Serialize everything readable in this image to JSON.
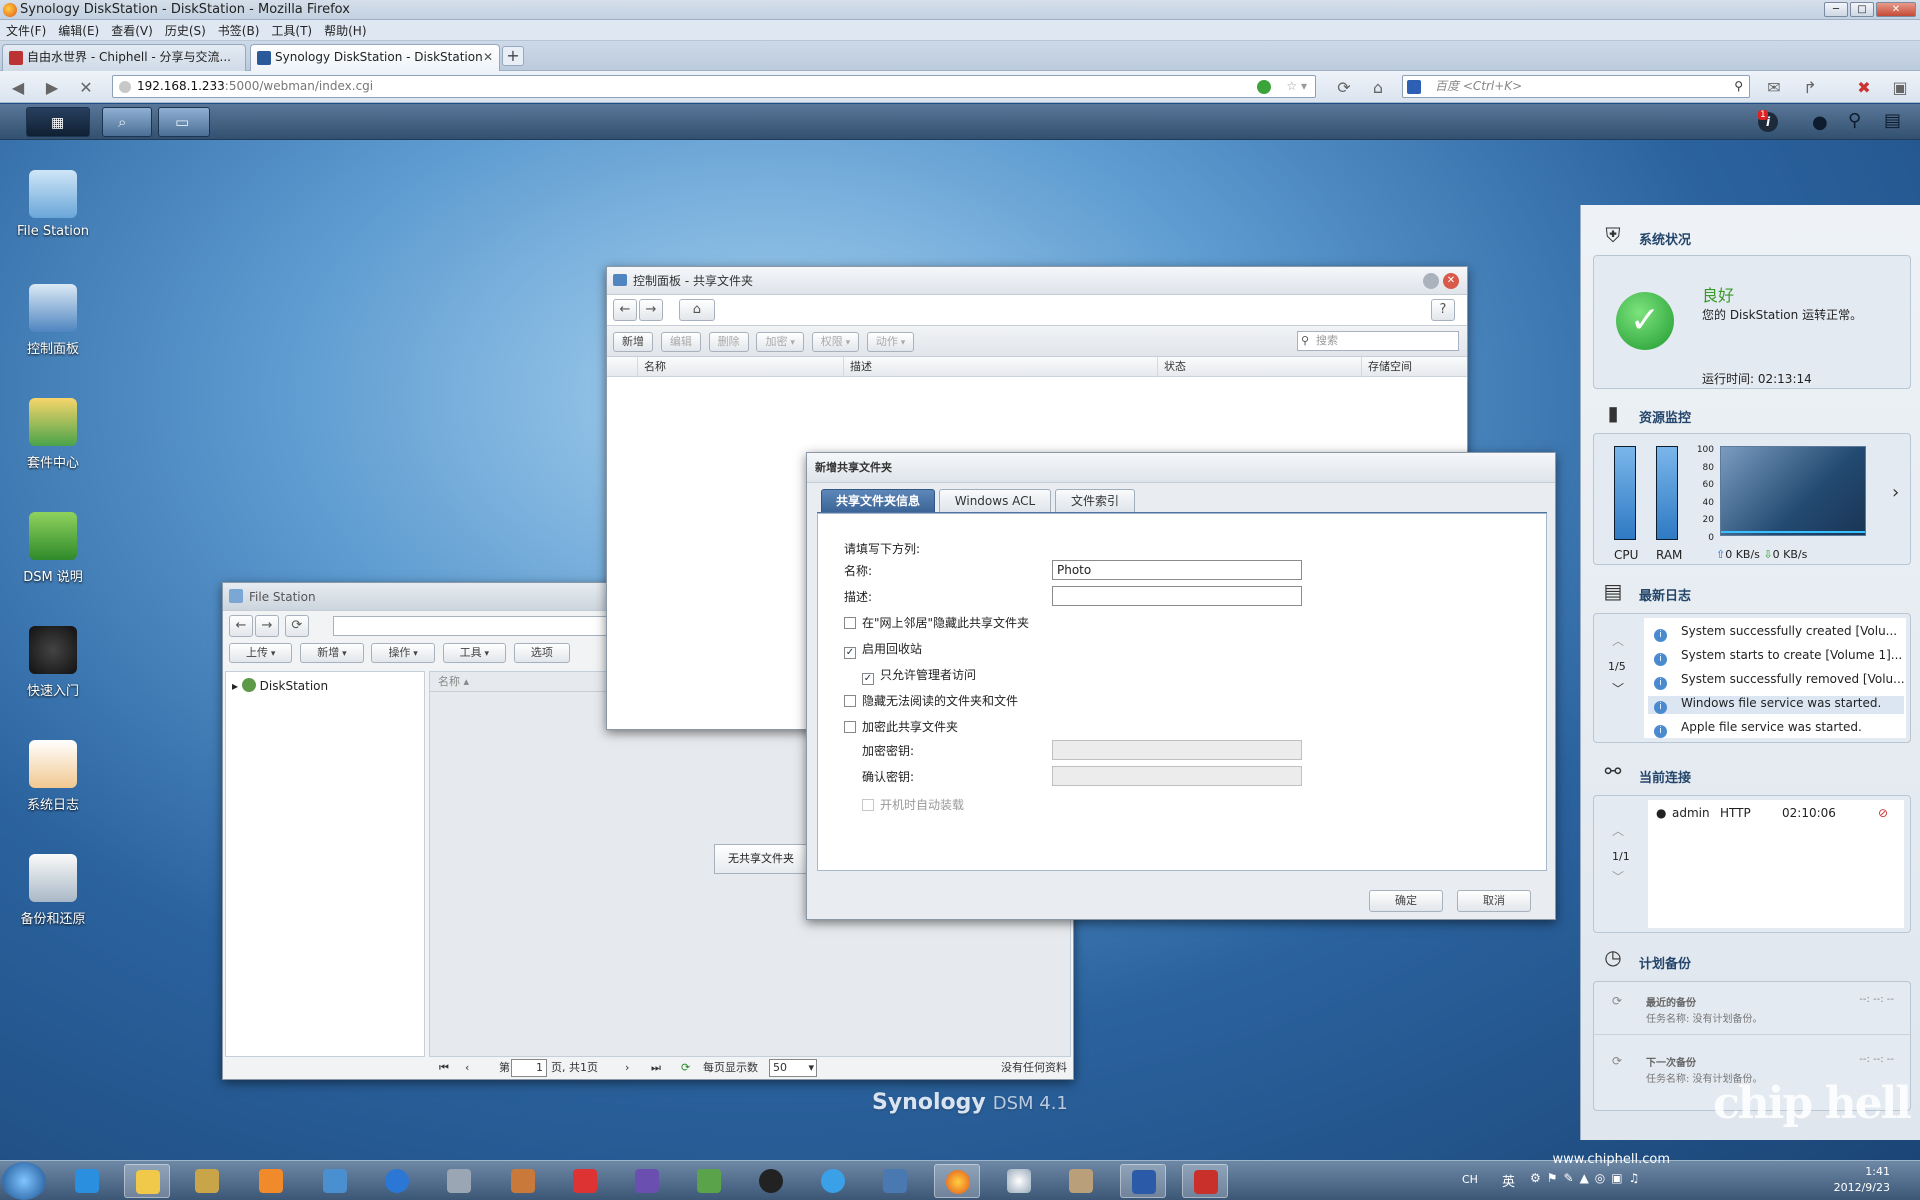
{
  "browser": {
    "title": "Synology DiskStation - DiskStation - Mozilla Firefox",
    "menu": [
      "文件(F)",
      "编辑(E)",
      "查看(V)",
      "历史(S)",
      "书签(B)",
      "工具(T)",
      "帮助(H)"
    ],
    "tabs": [
      {
        "label": "自由水世界 - Chiphell - 分享与交流..."
      },
      {
        "label": "Synology DiskStation - DiskStation"
      }
    ],
    "url_host": "192.168.1.233",
    "url_path": ":5000/webman/index.cgi",
    "search_placeholder": "百度 <Ctrl+K>"
  },
  "dsm": {
    "notification_count": "1"
  },
  "desktop": {
    "icons": [
      {
        "label": "File Station"
      },
      {
        "label": "控制面板"
      },
      {
        "label": "套件中心"
      },
      {
        "label": "DSM 说明"
      },
      {
        "label": "快速入门"
      },
      {
        "label": "系统日志"
      },
      {
        "label": "备份和还原"
      }
    ],
    "logo": "Synology",
    "logo_version": "DSM 4.1"
  },
  "control_panel": {
    "title": "控制面板 - 共享文件夹",
    "toolbar": [
      "新增",
      "编辑",
      "删除",
      "加密",
      "权限",
      "动作"
    ],
    "search_placeholder": "搜索",
    "columns": [
      "名称",
      "描述",
      "状态",
      "存储空间"
    ]
  },
  "file_station": {
    "title": "File Station",
    "toolbar": [
      "上传",
      "新增",
      "操作",
      "工具",
      "选项"
    ],
    "tree_root": "DiskStation",
    "col_name": "名称",
    "empty_msg": "无共享文件夹",
    "pager": {
      "page_prefix": "第",
      "page_value": "1",
      "page_suffix": "页, 共1页",
      "per_page_label": "每页显示数",
      "per_page_value": "50",
      "status": "没有任何资料"
    }
  },
  "dialog": {
    "title": "新增共享文件夹",
    "tabs": [
      "共享文件夹信息",
      "Windows ACL",
      "文件索引"
    ],
    "intro": "请填写下方列:",
    "name_label": "名称:",
    "name_value": "Photo",
    "desc_label": "描述:",
    "desc_value": "",
    "opt_hide_network": "在\"网上邻居\"隐藏此共享文件夹",
    "opt_recycle": "启用回收站",
    "opt_admin_only": "只允许管理者访问",
    "opt_hide_unreadable": "隐藏无法阅读的文件夹和文件",
    "opt_encrypt": "加密此共享文件夹",
    "enc_key_label": "加密密钥:",
    "confirm_key_label": "确认密钥:",
    "opt_automount": "开机时自动装载",
    "ok": "确定",
    "cancel": "取消"
  },
  "right_panel": {
    "status": {
      "title": "系统状况",
      "state": "良好",
      "message": "您的 DiskStation 运转正常。",
      "uptime": "运行时间: 02:13:14"
    },
    "resource": {
      "title": "资源监控",
      "cpu_label": "CPU",
      "ram_label": "RAM",
      "cpu_level_pct": 100,
      "ram_level_pct": 100,
      "y_ticks": [
        "100",
        "80",
        "60",
        "40",
        "20",
        "0"
      ],
      "up": "0 KB/s",
      "down": "0 KB/s"
    },
    "logs": {
      "title": "最新日志",
      "page": "1/5",
      "items": [
        "System successfully created [Volu...",
        "System starts to create [Volume 1]...",
        "System successfully removed [Volu...",
        "Windows file service was started.",
        "Apple file service was started."
      ]
    },
    "connections": {
      "title": "当前连接",
      "page": "1/1",
      "user": "admin",
      "protocol": "HTTP",
      "time": "02:10:06"
    },
    "backup": {
      "title": "计划备份",
      "recent_label": "最近的备份",
      "recent_task": "任务名称: 没有计划备份。",
      "recent_time": "--: --: --",
      "next_label": "下一次备份",
      "next_task": "任务名称: 没有计划备份。",
      "next_time": "--: --: --"
    }
  },
  "taskbar": {
    "ime": "CH",
    "ime2": "英",
    "time": "1:41",
    "date": "2012/9/23"
  },
  "watermark": {
    "text": "chip hell",
    "site": "www.chiphell.com"
  }
}
